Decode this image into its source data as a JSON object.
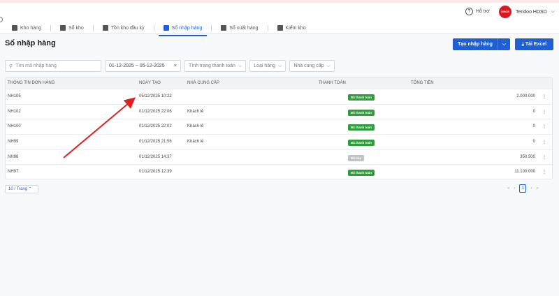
{
  "header": {
    "help": "Hỗ trợ",
    "avatar_text": "SINCE 1991",
    "user_name": "Tendoo HDSD",
    "user_chevron": "⌵"
  },
  "tabs": [
    {
      "label": "Kho hàng",
      "icon": "warehouse-icon"
    },
    {
      "label": "Sổ kho",
      "icon": "book-icon"
    },
    {
      "label": "Tồn kho đầu kỳ",
      "icon": "stock-icon"
    },
    {
      "label": "Sổ nhập hàng",
      "icon": "import-icon"
    },
    {
      "label": "Sổ xuất hàng",
      "icon": "export-icon"
    },
    {
      "label": "Kiểm kho",
      "icon": "check-icon"
    }
  ],
  "page": {
    "title": "Sổ nhập hàng",
    "create_button": "Tạo nhập hàng",
    "create_dropdown": "⌵",
    "excel_button": "⤓ Tải Excel"
  },
  "filters": {
    "search_placeholder": "Tìm mã nhập hàng",
    "search_icon": "⚲",
    "date_range": "01-12-2025 ~ 05-12-2025",
    "date_clear": "×",
    "payment_status": "Tình trạng thanh toán",
    "item_type": "Loại hàng",
    "supplier": "Nhà cung cấp",
    "chevron": "⌵"
  },
  "table": {
    "columns": [
      "Thông tin đơn hàng",
      "Ngày tạo",
      "Nhà cung cấp",
      "Thanh toán",
      "Tổng tiền"
    ],
    "rows": [
      {
        "id": "NH105",
        "date": "05/12/2025 10:22",
        "supplier": "",
        "status": "Đã thanh toán",
        "total": "2.000.000"
      },
      {
        "id": "NH102",
        "date": "01/12/2025 22:06",
        "supplier": "Khách lẻ",
        "status": "Đã thanh toán",
        "total": "0"
      },
      {
        "id": "NH100",
        "date": "01/12/2025 22:02",
        "supplier": "Khách lẻ",
        "status": "Đã thanh toán",
        "total": "0"
      },
      {
        "id": "NH99",
        "date": "01/12/2025 21:56",
        "supplier": "Khách lẻ",
        "status": "Đã thanh toán",
        "total": "0"
      },
      {
        "id": "NH98",
        "date": "01/12/2025 14:37",
        "supplier": "",
        "status": "Đã hủy",
        "total": "350.500"
      },
      {
        "id": "NH97",
        "date": "01/12/2025 12:39",
        "supplier": "",
        "status": "Đã thanh toán",
        "total": "11.100.000"
      }
    ],
    "row_menu": "⋮"
  },
  "pagination": {
    "page_size": "10 / Trang ⌃",
    "current_page": "1",
    "first": "«",
    "prev": "‹",
    "next": "›",
    "last": "»"
  },
  "colors": {
    "accent": "#1f5fd6",
    "paid": "#2e9e3a",
    "cancelled": "#bfc3c8",
    "arrow": "#e02020"
  }
}
